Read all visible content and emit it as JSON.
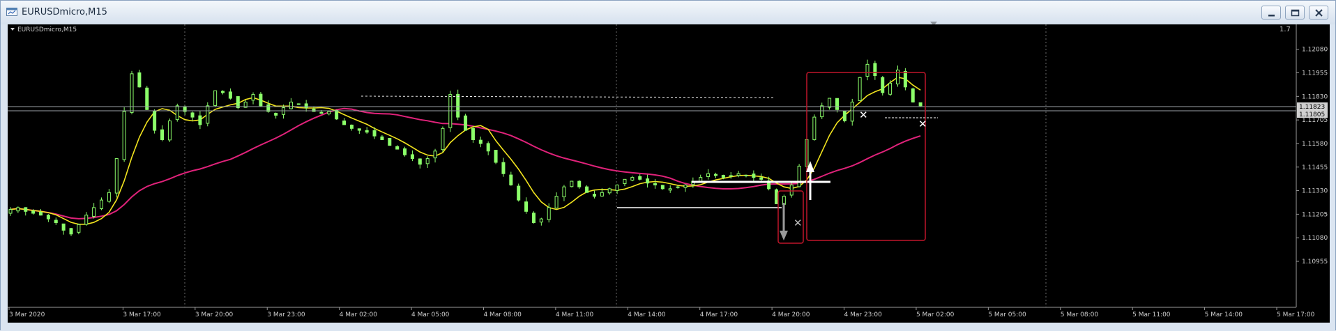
{
  "window": {
    "title": "EURUSDmicro,M15"
  },
  "chart": {
    "label": "EURUSDmicro,M15",
    "ratio_label": "1.7",
    "price_current_box_1": "1.11823",
    "price_current_box_2": "1.11805"
  },
  "chart_data": {
    "type": "candlestick",
    "symbol": "EURUSDmicro",
    "timeframe": "M15",
    "y_ticks": [
      "1.12080",
      "1.11955",
      "1.11830",
      "1.11705",
      "1.11580",
      "1.11455",
      "1.11330",
      "1.11205",
      "1.11080",
      "1.10955"
    ],
    "x_ticks": [
      "3 Mar 2020",
      "3 Mar 17:00",
      "3 Mar 20:00",
      "3 Mar 23:00",
      "4 Mar 02:00",
      "4 Mar 05:00",
      "4 Mar 08:00",
      "4 Mar 11:00",
      "4 Mar 14:00",
      "4 Mar 17:00",
      "4 Mar 20:00",
      "4 Mar 23:00",
      "5 Mar 02:00",
      "5 Mar 05:00",
      "5 Mar 08:00",
      "5 Mar 11:00",
      "5 Mar 14:00",
      "5 Mar 17:00"
    ],
    "ylim": [
      1.10955,
      1.12175
    ],
    "grid": true,
    "series": [
      {
        "name": "",
        "style": "yellow-ma"
      },
      {
        "name": "",
        "style": "magenta-ma"
      }
    ],
    "close_points": [
      1.1123,
      1.1124,
      1.1122,
      1.1121,
      1.112,
      1.1118,
      1.1116,
      1.1112,
      1.111,
      1.1115,
      1.112,
      1.1124,
      1.1128,
      1.1132,
      1.115,
      1.1175,
      1.1195,
      1.1188,
      1.1176,
      1.1165,
      1.116,
      1.117,
      1.1178,
      1.1175,
      1.1172,
      1.1168,
      1.1178,
      1.1186,
      1.1185,
      1.1182,
      1.1177,
      1.118,
      1.1184,
      1.1178,
      1.1175,
      1.1173,
      1.1177,
      1.118,
      1.1179,
      1.1177,
      1.1175,
      1.1174,
      1.1175,
      1.1171,
      1.1168,
      1.1166,
      1.1165,
      1.1164,
      1.1162,
      1.116,
      1.1157,
      1.1155,
      1.1152,
      1.115,
      1.1147,
      1.115,
      1.1154,
      1.1166,
      1.1184,
      1.1172,
      1.1165,
      1.116,
      1.1158,
      1.1154,
      1.1148,
      1.1142,
      1.1136,
      1.1128,
      1.1122,
      1.1116,
      1.1118,
      1.1124,
      1.113,
      1.1135,
      1.1138,
      1.1135,
      1.1132,
      1.113,
      1.1132,
      1.1134,
      1.1136,
      1.1139,
      1.114,
      1.1139,
      1.1137,
      1.1136,
      1.1134,
      1.1134,
      1.1135,
      1.1136,
      1.1138,
      1.114,
      1.1142,
      1.1141,
      1.114,
      1.1141,
      1.1142,
      1.1141,
      1.114,
      1.1139,
      1.1134,
      1.1126,
      1.113,
      1.1136,
      1.1146,
      1.116,
      1.1172,
      1.1178,
      1.1182,
      1.1176,
      1.117,
      1.118,
      1.1193,
      1.12,
      1.1194,
      1.1185,
      1.119,
      1.1197,
      1.1188,
      1.118,
      1.1178
    ]
  }
}
